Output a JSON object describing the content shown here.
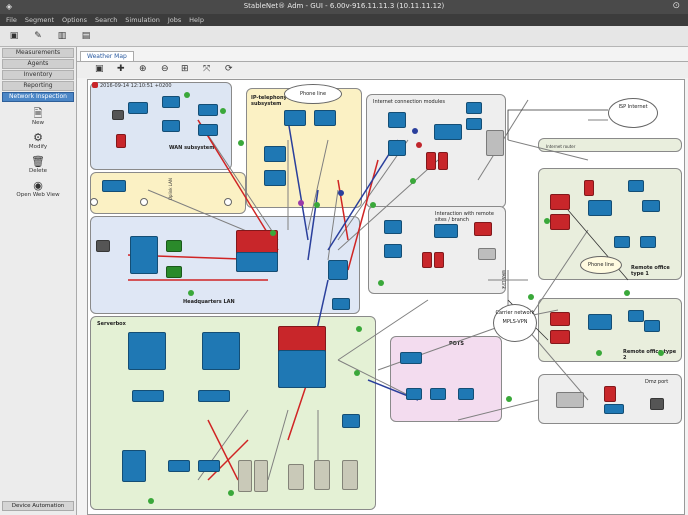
{
  "window": {
    "title": "StableNet® Adm - GUI - 6.00v-916.11.11.3 (10.11.11.12)"
  },
  "menubar": [
    "File",
    "Segment",
    "Options",
    "Search",
    "Simulation",
    "Jobs",
    "Help"
  ],
  "sidebar": {
    "items": [
      "Measurements",
      "Agents",
      "Inventory",
      "Reporting",
      "Network Inspection"
    ],
    "active_index": 4,
    "buttons": [
      {
        "label": "New",
        "icon": "new-map-icon"
      },
      {
        "label": "Modify",
        "icon": "gear-icon"
      },
      {
        "label": "Delete",
        "icon": "trash-icon"
      },
      {
        "label": "Open Web View",
        "icon": "web-view-icon"
      }
    ],
    "footer": "Device Automation"
  },
  "tab": {
    "label": "Weather Map"
  },
  "map": {
    "timestamp": "2016-09-14 12:10:51 +0200",
    "zones": {
      "wan": "WAN subsystem",
      "ip_tel": "IP-telephony subsystem",
      "hq_lan": "Headquarters LAN",
      "server": "Serverbox",
      "internet": "Internet connection modules",
      "remote_conn": "Interaction with remote sites / branch",
      "remote1": "Remote office type 1",
      "remote2": "Remote office type 2",
      "pots": "POTS",
      "dmz": "Dmz_ports"
    },
    "clouds": {
      "phone_top": "Phone line",
      "isp": "ISP Internet",
      "carrier": "Carrier network MPLS-VPN",
      "phone_right": "Phone line"
    },
    "labels": {
      "headquarters": "Headquarters LAN",
      "remote1": "Remote office type 1",
      "remote2": "Remote office type 2",
      "dmz": "Dmz port",
      "ir": "Internet router",
      "ug_vertical": "Uplink LAN",
      "wan_vertical": "WAN Link"
    }
  },
  "colors": {
    "status_ok": "#3aa83a",
    "status_warn": "#d6a400",
    "status_crit": "#c0262c",
    "device_blue": "#1f78b4",
    "device_red": "#c8262a",
    "zone_wan": "#dde6f3",
    "zone_tel": "#fbf1c4",
    "zone_hq": "#dfe7f5",
    "zone_server": "#e4f1d5",
    "zone_pots": "#f3dcef",
    "zone_remote": "#e9eedd",
    "zone_gray": "#eeeeee",
    "link_red": "#d02424",
    "link_blue": "#2a3f9c",
    "link_gray": "#808080"
  }
}
